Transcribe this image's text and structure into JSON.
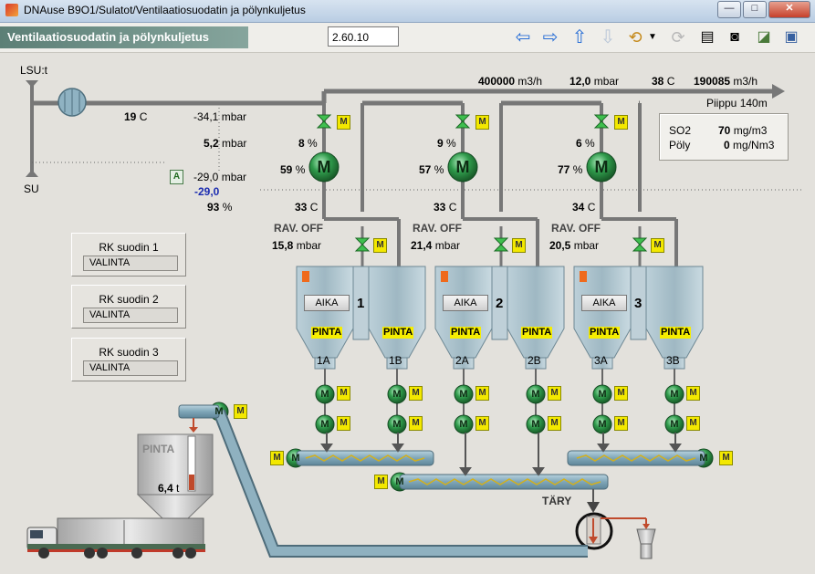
{
  "window": {
    "title": "DNAuse B9O1/Sulatot/Ventilaatiosuodatin ja pölynkuljetus"
  },
  "header": {
    "subtitle": "Ventilaatiosuodatin ja pölynkuljetus",
    "version": "2.60.10"
  },
  "toolbar": {
    "icons": [
      "back-arrow-icon",
      "forward-arrow-icon",
      "up-arrow-icon",
      "down-arrow-icon",
      "history-icon",
      "dropdown-icon",
      "refresh-icon",
      "print-icon",
      "camera-icon",
      "trend-icon",
      "window-icon"
    ]
  },
  "main_duct": {
    "flow": "400000",
    "flow_unit": "m3/h",
    "pressure": "12,0",
    "pressure_unit": "mbar",
    "temp": "38",
    "temp_unit": "C",
    "value2": "190085",
    "value2_unit": "m3/h",
    "pippu": "Piippu 140m"
  },
  "emissions": {
    "so2_label": "SO2",
    "so2_value": "70",
    "so2_unit": "mg/m3",
    "poly_label": "Pöly",
    "poly_value": "0",
    "poly_unit": "mg/Nm3"
  },
  "inlet": {
    "lsu_label": "LSU:t",
    "su_label": "SU",
    "temp": "19",
    "temp_unit": "C",
    "p1": "-34,1",
    "p1_unit": "mbar",
    "p2": "5,2",
    "p2_unit": "mbar",
    "a_label": "A",
    "p3": "-29,0",
    "p3_unit": "mbar",
    "p3_set": "-29,0",
    "pct": "93",
    "pct_unit": "%"
  },
  "filters": [
    {
      "num": "1",
      "damper_pct": "8",
      "fan_pct": "59",
      "temp": "33",
      "rav": "RAV. OFF",
      "dp": "15,8",
      "dp_unit": "mbar",
      "aika": "AIKA",
      "pinta": "PINTA",
      "hopper_a": "1A",
      "hopper_b": "1B"
    },
    {
      "num": "2",
      "damper_pct": "9",
      "fan_pct": "57",
      "temp": "33",
      "rav": "RAV. OFF",
      "dp": "21,4",
      "dp_unit": "mbar",
      "aika": "AIKA",
      "pinta": "PINTA",
      "hopper_a": "2A",
      "hopper_b": "2B"
    },
    {
      "num": "3",
      "damper_pct": "6",
      "fan_pct": "77",
      "temp": "34",
      "rav": "RAV. OFF",
      "dp": "20,5",
      "dp_unit": "mbar",
      "aika": "AIKA",
      "pinta": "PINTA",
      "hopper_a": "3A",
      "hopper_b": "3B"
    }
  ],
  "units": {
    "pct": "%",
    "c": "C"
  },
  "motor_label": "M",
  "m_badge": "M",
  "rk_panels": [
    {
      "title": "RK suodin 1",
      "value": "VALINTA"
    },
    {
      "title": "RK suodin 2",
      "value": "VALINTA"
    },
    {
      "title": "RK suodin 3",
      "value": "VALINTA"
    }
  ],
  "silo": {
    "pinta_label": "PINTA",
    "level": "6,4",
    "level_unit": "t",
    "level_fraction": 0.3
  },
  "tary_label": "TÄRY",
  "colors": {
    "pipe": "#757575",
    "motor": "#2f9a4b",
    "hopper": "#a9c1cc",
    "badge": "#f3e800",
    "conveyor": "#7fa6b8"
  }
}
